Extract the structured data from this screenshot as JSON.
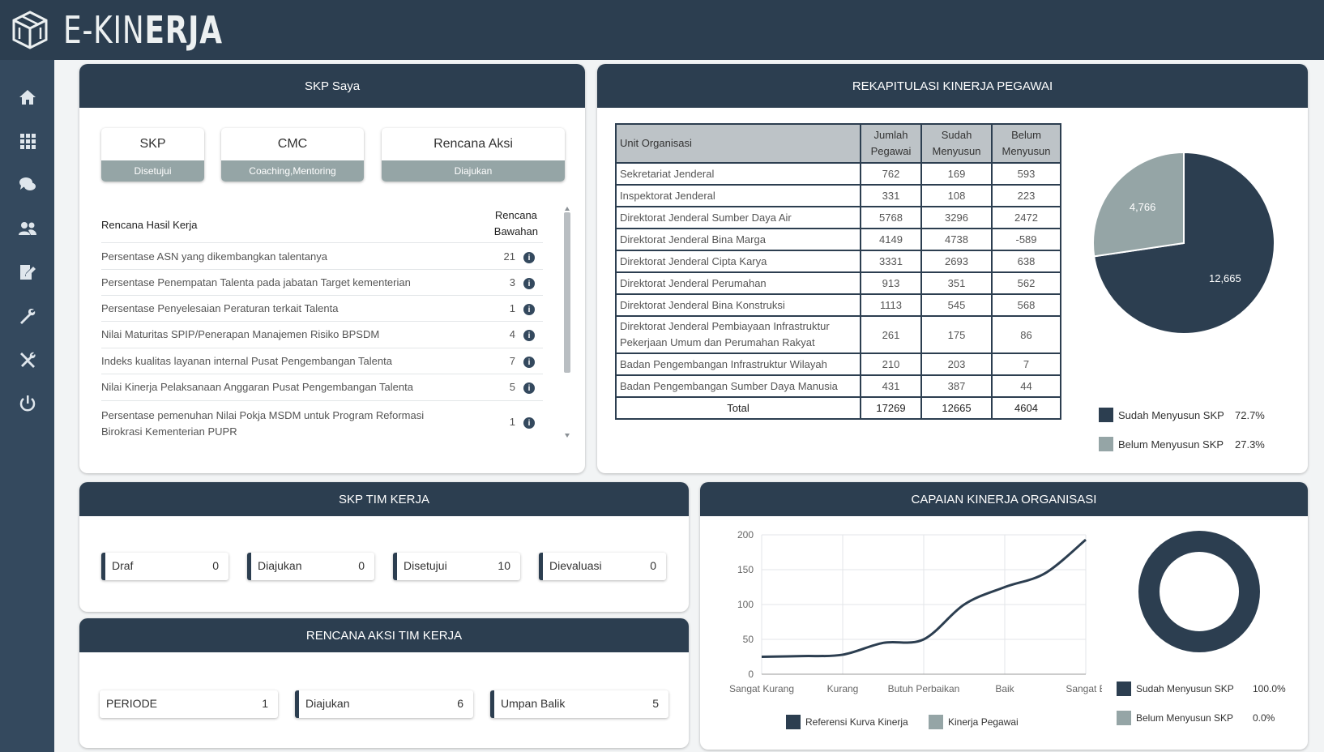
{
  "app": {
    "title": "E-KINERJA",
    "title_part1": "E-KIN",
    "title_part2": "ERJA"
  },
  "sidebar": {
    "items": [
      {
        "icon": "home-icon"
      },
      {
        "icon": "grid-icon"
      },
      {
        "icon": "chat-icon"
      },
      {
        "icon": "users-icon"
      },
      {
        "icon": "edit-icon"
      },
      {
        "icon": "wrench-icon"
      },
      {
        "icon": "tools-icon"
      },
      {
        "icon": "power-icon"
      }
    ]
  },
  "skp_saya": {
    "title": "SKP Saya",
    "tabs": [
      {
        "label": "SKP",
        "status": "Disetujui"
      },
      {
        "label": "CMC",
        "status": "Coaching,Mentoring"
      },
      {
        "label": "Rencana Aksi",
        "status": "Diajukan"
      }
    ],
    "header": {
      "col1": "Rencana Hasil Kerja",
      "col2_line1": "Rencana",
      "col2_line2": "Bawahan"
    },
    "rows": [
      {
        "text": "Persentase ASN yang dikembangkan talentanya",
        "value": "21"
      },
      {
        "text": "Persentase Penempatan Talenta pada jabatan Target kementerian",
        "value": "3"
      },
      {
        "text": "Persentase Penyelesaian Peraturan terkait Talenta",
        "value": "1"
      },
      {
        "text": "Nilai Maturitas SPIP/Penerapan Manajemen Risiko BPSDM",
        "value": "4"
      },
      {
        "text": "Indeks kualitas layanan internal Pusat Pengembangan Talenta",
        "value": "7"
      },
      {
        "text": "Nilai Kinerja Pelaksanaan Anggaran Pusat Pengembangan Talenta",
        "value": "5"
      },
      {
        "text_line1": "Persentase pemenuhan Nilai Pokja MSDM untuk Program Reformasi",
        "text_line2": "Birokrasi Kementerian PUPR",
        "value": "1"
      }
    ]
  },
  "rekap": {
    "title": "REKAPITULASI KINERJA PEGAWAI",
    "columns": {
      "unit": "Unit Organisasi",
      "jumlah_1": "Jumlah",
      "jumlah_2": "Pegawai",
      "sudah_1": "Sudah",
      "sudah_2": "Menyusun",
      "belum_1": "Belum",
      "belum_2": "Menyusun"
    },
    "rows": [
      {
        "unit": "Sekretariat Jenderal",
        "jumlah": "762",
        "sudah": "169",
        "belum": "593"
      },
      {
        "unit": "Inspektorat Jenderal",
        "jumlah": "331",
        "sudah": "108",
        "belum": "223"
      },
      {
        "unit": "Direktorat Jenderal Sumber Daya Air",
        "jumlah": "5768",
        "sudah": "3296",
        "belum": "2472"
      },
      {
        "unit": "Direktorat Jenderal Bina Marga",
        "jumlah": "4149",
        "sudah": "4738",
        "belum": "-589"
      },
      {
        "unit": "Direktorat Jenderal Cipta Karya",
        "jumlah": "3331",
        "sudah": "2693",
        "belum": "638"
      },
      {
        "unit": "Direktorat Jenderal Perumahan",
        "jumlah": "913",
        "sudah": "351",
        "belum": "562"
      },
      {
        "unit": "Direktorat Jenderal Bina Konstruksi",
        "jumlah": "1113",
        "sudah": "545",
        "belum": "568"
      },
      {
        "unit_line1": "Direktorat Jenderal Pembiayaan Infrastruktur",
        "unit_line2": "Pekerjaan Umum dan Perumahan Rakyat",
        "jumlah": "261",
        "sudah": "175",
        "belum": "86"
      },
      {
        "unit": "Badan Pengembangan Infrastruktur Wilayah",
        "jumlah": "210",
        "sudah": "203",
        "belum": "7"
      },
      {
        "unit": "Badan Pengembangan Sumber Daya Manusia",
        "jumlah": "431",
        "sudah": "387",
        "belum": "44"
      }
    ],
    "total": {
      "label": "Total",
      "jumlah": "17269",
      "sudah": "12665",
      "belum": "4604"
    },
    "legend": [
      {
        "label": "Sudah Menyusun SKP",
        "value": "72.7%",
        "color": "#2c3e50"
      },
      {
        "label": "Belum Menyusun SKP",
        "value": "27.3%",
        "color": "#95a5a6"
      }
    ]
  },
  "skp_tim": {
    "title": "SKP TIM KERJA",
    "boxes": [
      {
        "label": "Draf",
        "value": "0"
      },
      {
        "label": "Diajukan",
        "value": "0"
      },
      {
        "label": "Disetujui",
        "value": "10"
      },
      {
        "label": "Dievaluasi",
        "value": "0"
      }
    ]
  },
  "rencana_aksi_tim": {
    "title": "RENCANA AKSI TIM KERJA",
    "boxes": [
      {
        "label": "PERIODE",
        "value": "1"
      },
      {
        "label": "Diajukan",
        "value": "6"
      },
      {
        "label": "Umpan Balik",
        "value": "5"
      }
    ]
  },
  "capaian": {
    "title": "CAPAIAN KINERJA ORGANISASI",
    "legend_bottom": [
      {
        "label": "Referensi Kurva Kinerja",
        "color": "#2c3e50"
      },
      {
        "label": "Kinerja Pegawai",
        "color": "#95a5a6"
      }
    ],
    "donut_legend": [
      {
        "label": "Sudah Menyusun SKP",
        "value": "100.0%",
        "color": "#2c3e50"
      },
      {
        "label": "Belum Menyusun SKP",
        "value": "0.0%",
        "color": "#95a5a6"
      }
    ]
  },
  "chart_data": [
    {
      "type": "pie",
      "labels": [
        "Sudah Menyusun SKP",
        "Belum Menyusun SKP"
      ],
      "values": [
        12665,
        4766
      ],
      "data_labels": [
        "12,665",
        "4,766"
      ],
      "colors": [
        "#2c3e50",
        "#95a5a6"
      ]
    },
    {
      "type": "line",
      "categories": [
        "Sangat Kurang",
        "Kurang",
        "Butuh Perbaikan",
        "Baik",
        "Sangat B"
      ],
      "ylim": [
        0,
        200
      ],
      "yticks": [
        "0",
        "50",
        "100",
        "150",
        "200"
      ],
      "grid": true,
      "series": [
        {
          "name": "Referensi Kurva Kinerja",
          "color": "#2c3e50",
          "x": [
            0,
            0.5,
            1,
            1.5,
            2,
            2.5,
            3,
            3.5,
            4
          ],
          "values": [
            25,
            26,
            28,
            45,
            50,
            100,
            125,
            145,
            193
          ]
        }
      ]
    },
    {
      "type": "pie",
      "labels": [
        "Sudah Menyusun SKP",
        "Belum Menyusun SKP"
      ],
      "values": [
        100,
        0
      ],
      "donut": true
    }
  ]
}
